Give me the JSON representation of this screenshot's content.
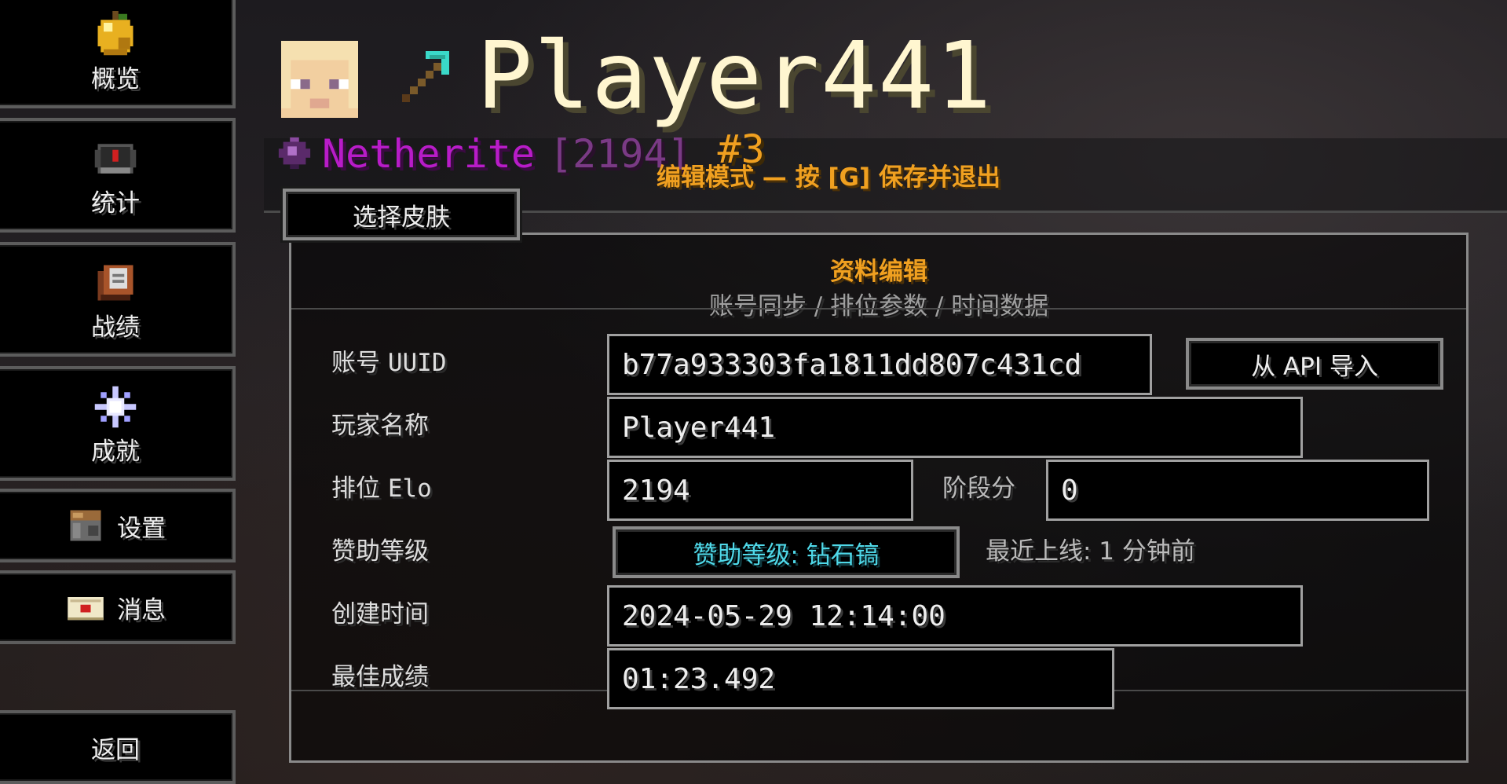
{
  "sidebar": {
    "items": [
      {
        "label": "概览",
        "icon": "golden-apple-icon"
      },
      {
        "label": "统计",
        "icon": "compass-icon"
      },
      {
        "label": "战绩",
        "icon": "book-icon"
      },
      {
        "label": "成就",
        "icon": "nether-star-icon"
      },
      {
        "label": "设置",
        "icon": "crafting-table-icon"
      },
      {
        "label": "消息",
        "icon": "envelope-icon"
      }
    ],
    "back_label": "返回"
  },
  "header": {
    "player_name": "Player441",
    "tier": "Netherite",
    "elo_bracket": "[2194]",
    "rank_position": "#3",
    "edit_banner": "编辑模式 — 按 [G] 保存并退出",
    "skin_button": "选择皮肤"
  },
  "panel": {
    "title": "资料编辑",
    "subtitle": "账号同步 / 排位参数 / 时间数据",
    "uuid_label_cn": "账号",
    "uuid_label_en": "UUID",
    "uuid_value": "b77a933303fa1811dd807c431cd",
    "api_button": "从 API 导入",
    "name_label": "玩家名称",
    "name_value": "Player441",
    "elo_label_cn": "排位",
    "elo_label_en": "Elo",
    "elo_value": "2194",
    "stage_label": "阶段分",
    "stage_value": "0",
    "sponsor_label": "赞助等级",
    "sponsor_button": "赞助等级: 钻石镐",
    "last_online": "最近上线: 1 分钟前",
    "created_label": "创建时间",
    "created_value": "2024-05-29 12:14:00",
    "best_label": "最佳成绩",
    "best_value": "01:23.492"
  },
  "colors": {
    "accent": "#f0a020",
    "tier": "#b81cc8",
    "sponsor": "#4fd8e8"
  }
}
